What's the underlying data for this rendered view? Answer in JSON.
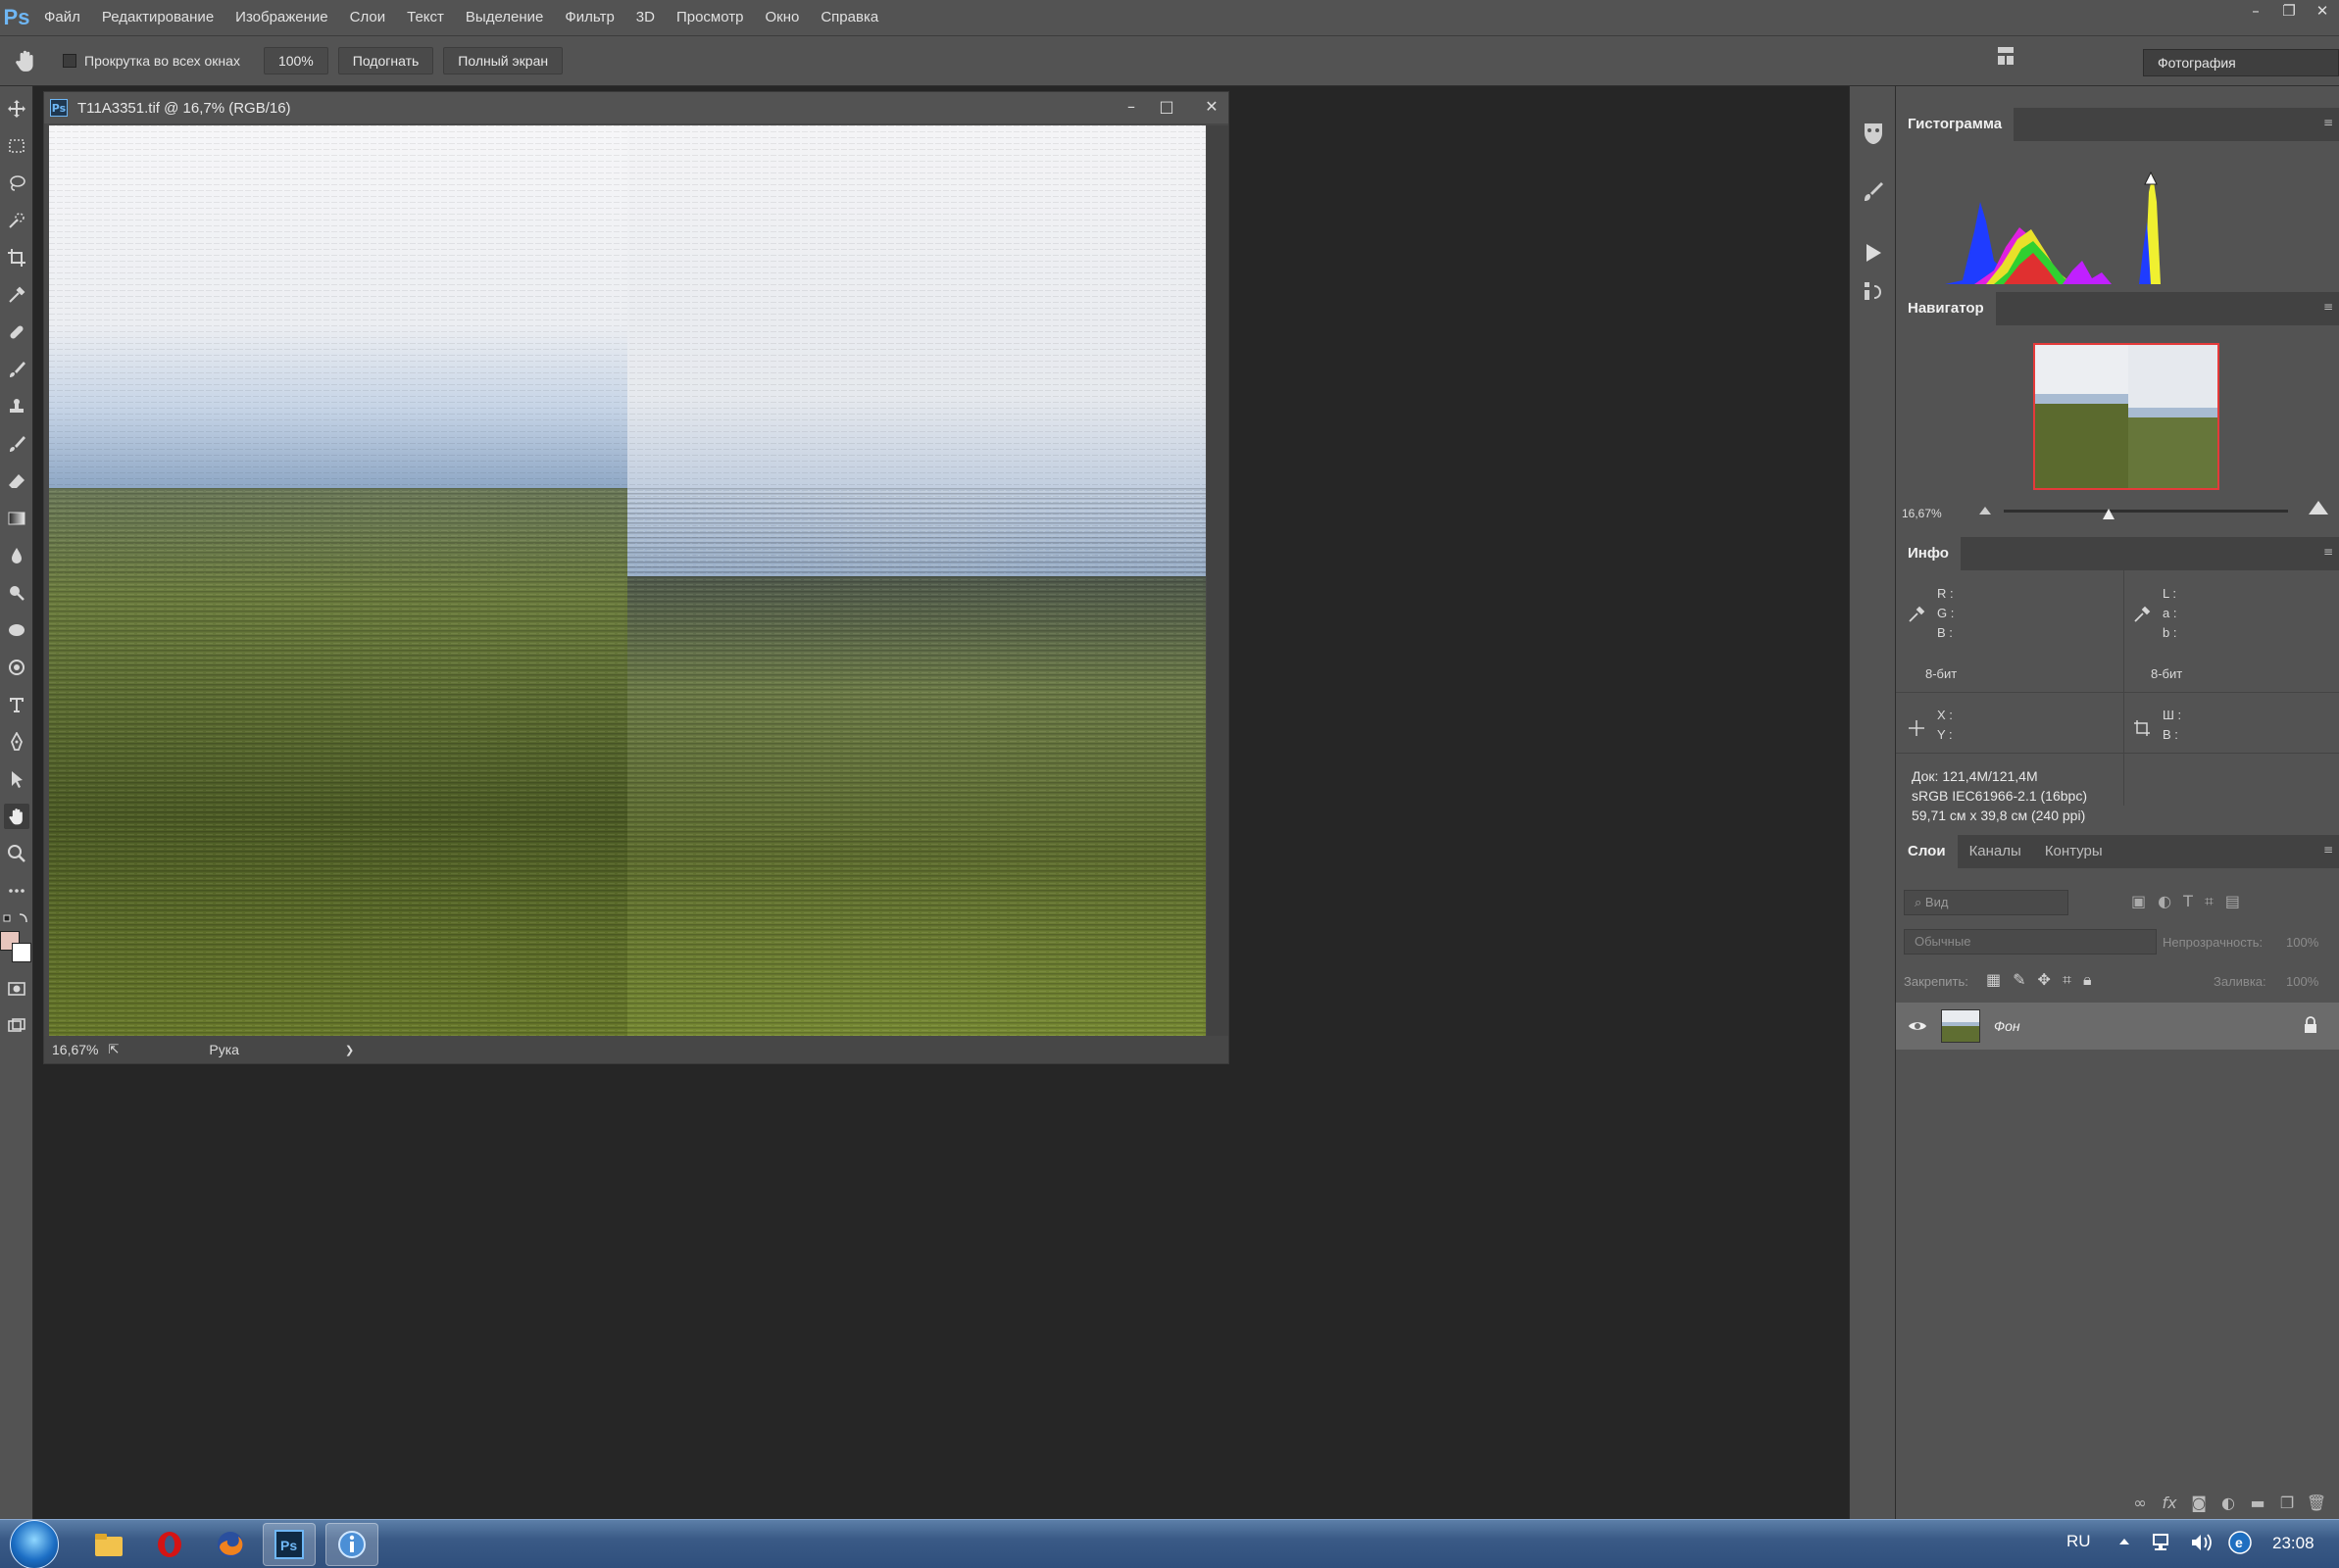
{
  "app": {
    "logo": "Ps",
    "menu": [
      "Файл",
      "Редактирование",
      "Изображение",
      "Слои",
      "Текст",
      "Выделение",
      "Фильтр",
      "3D",
      "Просмотр",
      "Окно",
      "Справка"
    ],
    "window_controls": [
      "–",
      "❐",
      "✕"
    ]
  },
  "options_bar": {
    "scroll_all_label": "Прокрутка во всех окнах",
    "zoom_100": "100%",
    "fit_label": "Подогнать",
    "fullscreen_label": "Полный экран",
    "workspace": "Фотография"
  },
  "document": {
    "title": "T11A3351.tif @ 16,7% (RGB/16)",
    "zoom": "16,67%",
    "status_tool": "Рука",
    "status_arrow": "❯"
  },
  "panels": {
    "histogram": {
      "tab": "Гистограмма"
    },
    "navigator": {
      "tab": "Навигатор",
      "zoom": "16,67%"
    },
    "info": {
      "tab": "Инфо",
      "rgb_labels": "R :\nG :\nB :",
      "lab_labels": "L :\na :\nb :",
      "bit_left": "8-бит",
      "bit_right": "8-бит",
      "xy_labels": "X :\nY :",
      "wh_labels": "Ш :\nВ :",
      "doc": "Док: 121,4M/121,4M",
      "profile": "sRGB IEC61966-2.1 (16bpc)",
      "size": "59,71 см x 39,8 см (240 ppi)"
    },
    "layers": {
      "tabs": [
        "Слои",
        "Каналы",
        "Контуры"
      ],
      "search_placeholder": "Вид",
      "blend_mode": "Обычные",
      "opacity_label": "Непрозрачность:",
      "opacity_value": "100%",
      "lock_label": "Закрепить:",
      "fill_label": "Заливка:",
      "fill_value": "100%",
      "layer_name": "Фон"
    }
  },
  "taskbar": {
    "language": "RU",
    "time": "23:08"
  },
  "colors": {
    "panel_bg": "#535353",
    "workspace_bg": "#262626",
    "accent_red": "#e53a3a"
  }
}
